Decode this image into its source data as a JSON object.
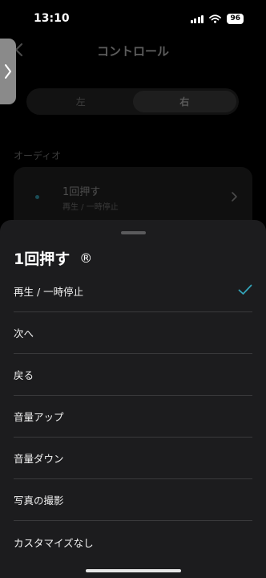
{
  "status_bar": {
    "time": "13:10",
    "battery": "96",
    "icons": [
      "cellular-signal-icon",
      "wifi-icon",
      "battery-icon"
    ]
  },
  "page": {
    "title": "コントロール",
    "tabs": [
      {
        "label": "左",
        "selected": false
      },
      {
        "label": "右",
        "selected": true
      }
    ],
    "section_label": "オーディオ",
    "card": {
      "title": "1回押す",
      "subtitle": "再生 / 一時停止"
    }
  },
  "sheet": {
    "title": "1回押す",
    "title_mark": "®",
    "options": [
      {
        "label": "再生 / 一時停止",
        "selected": true
      },
      {
        "label": "次へ",
        "selected": false
      },
      {
        "label": "戻る",
        "selected": false
      },
      {
        "label": "音量アップ",
        "selected": false
      },
      {
        "label": "音量ダウン",
        "selected": false
      },
      {
        "label": "写真の撮影",
        "selected": false
      },
      {
        "label": "カスタマイズなし",
        "selected": false
      }
    ]
  },
  "colors": {
    "accent": "#33a3b8",
    "sheet_background": "#1c1c1e",
    "divider": "#3a3a3c",
    "side_handle": "#8a8a8a"
  }
}
